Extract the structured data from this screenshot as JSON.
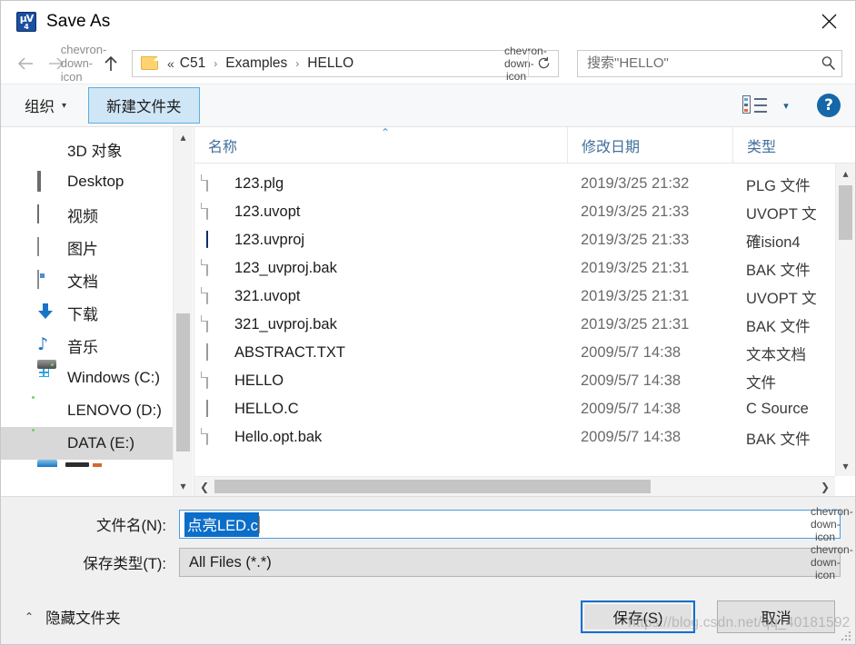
{
  "window": {
    "title": "Save As",
    "app_icon": "uvision4-icon",
    "close_label": "✕"
  },
  "nav": {
    "back_icon": "arrow-left-icon",
    "forward_icon": "arrow-right-icon",
    "recent_icon": "chevron-down-icon",
    "up_icon": "arrow-up-icon",
    "folder_icon": "folder-icon",
    "breadcrumb_ellipsis": "«",
    "breadcrumbs": [
      "C51",
      "Examples",
      "HELLO"
    ],
    "separator": "›",
    "dropdown_icon": "chevron-down-icon",
    "refresh_icon": "refresh-icon"
  },
  "search": {
    "placeholder": "搜索\"HELLO\"",
    "value": "",
    "icon": "search-icon"
  },
  "toolbar": {
    "organize_label": "组织",
    "organize_caret": "▾",
    "new_folder_label": "新建文件夹",
    "view_icon": "view-layout-icon",
    "view_caret": "▾",
    "help_label": "?",
    "help_icon": "help-icon"
  },
  "sidebar": {
    "items": [
      {
        "label": "3D 对象",
        "icon": "3d-objects-icon",
        "selected": false
      },
      {
        "label": "Desktop",
        "icon": "desktop-icon",
        "selected": false
      },
      {
        "label": "视频",
        "icon": "videos-icon",
        "selected": false
      },
      {
        "label": "图片",
        "icon": "pictures-icon",
        "selected": false
      },
      {
        "label": "文档",
        "icon": "documents-icon",
        "selected": false
      },
      {
        "label": "下载",
        "icon": "downloads-icon",
        "selected": false
      },
      {
        "label": "音乐",
        "icon": "music-icon",
        "selected": false
      },
      {
        "label": "Windows (C:)",
        "icon": "windows-drive-icon",
        "selected": false
      },
      {
        "label": "LENOVO (D:)",
        "icon": "drive-icon",
        "selected": false
      },
      {
        "label": "DATA (E:)",
        "icon": "drive-icon",
        "selected": true
      }
    ],
    "scroll_up_icon": "chevron-up-icon",
    "scroll_down_icon": "chevron-down-icon"
  },
  "filelist": {
    "columns": [
      "名称",
      "修改日期",
      "类型"
    ],
    "sort_indicator": "⌃",
    "rows": [
      {
        "name": "123.plg",
        "icon": "blank-file-icon",
        "date": "2019/3/25 21:32",
        "type": "PLG 文件"
      },
      {
        "name": "123.uvopt",
        "icon": "blank-file-icon",
        "date": "2019/3/25 21:33",
        "type": "UVOPT 文"
      },
      {
        "name": "123.uvproj",
        "icon": "uvision4-icon",
        "date": "2019/3/25 21:33",
        "type": "確ision4"
      },
      {
        "name": "123_uvproj.bak",
        "icon": "blank-file-icon",
        "date": "2019/3/25 21:31",
        "type": "BAK 文件"
      },
      {
        "name": "321.uvopt",
        "icon": "blank-file-icon",
        "date": "2019/3/25 21:31",
        "type": "UVOPT 文"
      },
      {
        "name": "321_uvproj.bak",
        "icon": "blank-file-icon",
        "date": "2019/3/25 21:31",
        "type": "BAK 文件"
      },
      {
        "name": "ABSTRACT.TXT",
        "icon": "text-file-icon",
        "date": "2009/5/7 14:38",
        "type": "文本文档"
      },
      {
        "name": "HELLO",
        "icon": "blank-file-icon",
        "date": "2009/5/7 14:38",
        "type": "文件"
      },
      {
        "name": "HELLO.C",
        "icon": "c-source-icon",
        "date": "2009/5/7 14:38",
        "type": "C Source"
      },
      {
        "name": "Hello.opt.bak",
        "icon": "blank-file-icon",
        "date": "2009/5/7 14:38",
        "type": "BAK 文件"
      }
    ],
    "scroll_left_icon": "chevron-left-icon",
    "scroll_right_icon": "chevron-right-icon",
    "scroll_up_icon": "chevron-up-icon",
    "scroll_down_icon": "chevron-down-icon"
  },
  "form": {
    "filename_label": "文件名(N):",
    "filename_value": "点亮LED.c",
    "filetype_label": "保存类型(T):",
    "filetype_value": "All Files (*.*)",
    "dropdown_icon": "chevron-down-icon"
  },
  "footer": {
    "hide_folders_label": "隐藏文件夹",
    "hide_folders_caret": "⌃",
    "save_label": "保存(S)",
    "cancel_label": "取消"
  },
  "watermark": "https://blog.csdn.net/qq_40181592",
  "colors": {
    "accent": "#0a70d2",
    "header_text": "#41709c",
    "selection": "#0c6ec9",
    "new_folder_bg": "#cfe6f7",
    "help_blue": "#1467a8"
  }
}
